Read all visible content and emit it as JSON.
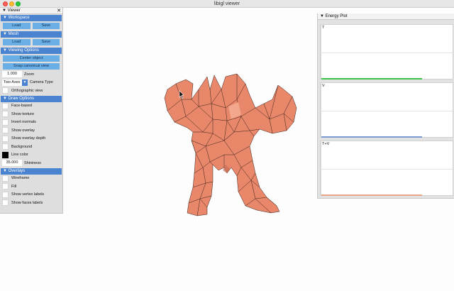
{
  "window": {
    "title": "libigl viewer"
  },
  "viewer": {
    "title": "Viewer",
    "workspace": {
      "label": "Workspace",
      "load": "Load",
      "save": "Save"
    },
    "mesh": {
      "label": "Mesh",
      "load": "Load",
      "save": "Save"
    },
    "viewing_options": {
      "label": "Viewing Options",
      "center_object": "Center object",
      "snap_view": "Snap canonical view",
      "zoom_value": "1.000",
      "zoom_label": "Zoom",
      "camera_type_value": "Two Axes",
      "camera_type_label": "Camera Type",
      "orthographic": "Orthographic view"
    },
    "draw_options": {
      "label": "Draw Options",
      "items": [
        "Face-based",
        "Show texture",
        "Invert normals",
        "Show overlay",
        "Show overlay depth",
        "Background"
      ],
      "line_color": "Line color",
      "shininess_value": "35.000",
      "shininess_label": "Shininess"
    },
    "overlays": {
      "label": "Overlays",
      "items": [
        "Wireframe",
        "Fill",
        "Show vertex labels",
        "Show faces labels"
      ]
    }
  },
  "energy_plot": {
    "title": "Energy Plot",
    "plots": [
      {
        "label": "T",
        "color": "#3cc24a"
      },
      {
        "label": "V",
        "color": "#7a9ad0"
      },
      {
        "label": "T+V",
        "color": "#e8a58a"
      }
    ]
  },
  "mesh_color": "#e8876a",
  "accent": "#4a83cf"
}
